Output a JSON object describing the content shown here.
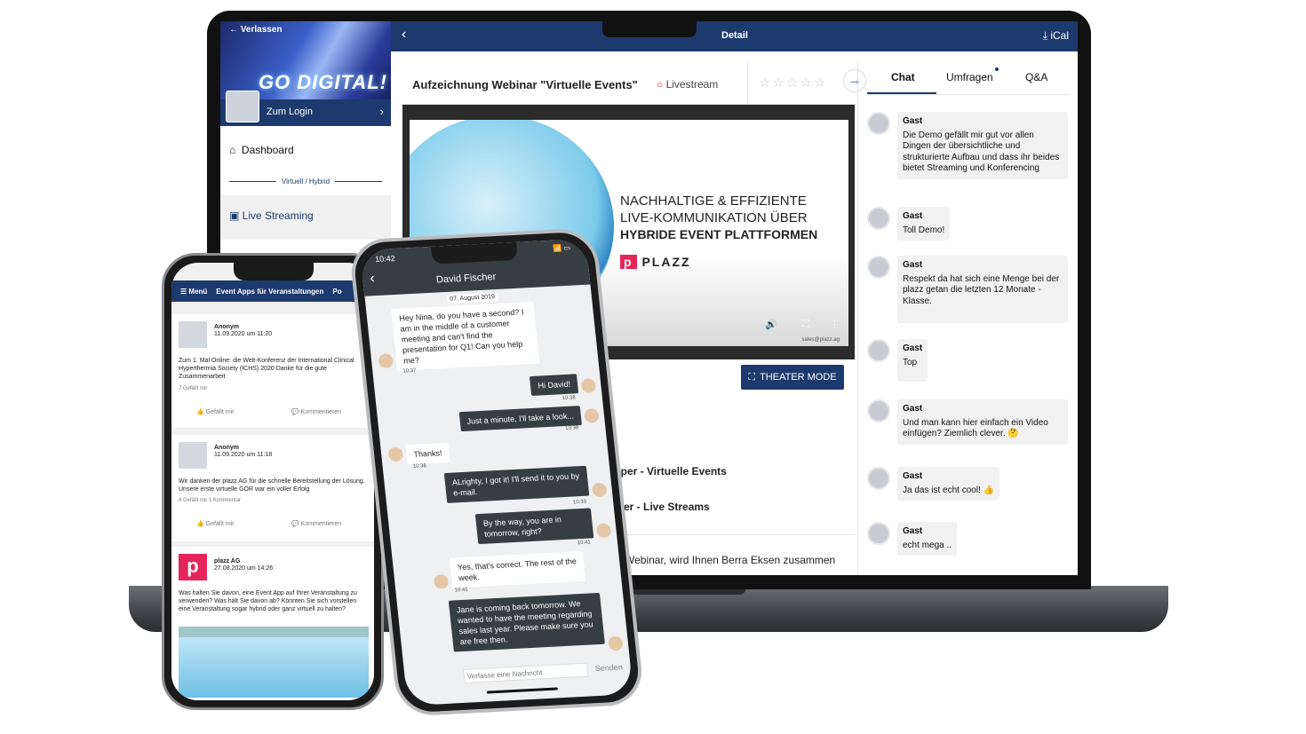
{
  "laptop": {
    "sidebar": {
      "leave": "Verlassen",
      "banner_text": "GO DIGITAL!",
      "login": "Zum Login",
      "items": [
        {
          "label": "Dashboard",
          "icon": "home-icon"
        },
        {
          "label": "Live Streaming",
          "icon": "video-camera-icon"
        }
      ],
      "section": "Virtuell / Hybrid"
    },
    "topbar": {
      "title": "Detail",
      "ical": "iCal"
    },
    "event": {
      "title": "Aufzeichnung Webinar \"Virtuelle Events\"",
      "badge": "Livestream",
      "rating": 0,
      "rating_max": 5
    },
    "slide": {
      "line1": "NACHHALTIGE & EFFIZIENTE",
      "line2": "LIVE-KOMMUNIKATION ÜBER",
      "line3": "HYBRIDE EVENT PLATTFORMEN",
      "brand": "PLAZZ",
      "email": "sales@plazz.ag"
    },
    "theater_mode": "THEATER MODE",
    "docs": [
      "epaper - Virtuelle Events",
      "aper - Live Streams"
    ],
    "description": "Webinar, wird Ihnen Berra Eksen zusammen",
    "tabs": [
      {
        "label": "Chat",
        "active": true
      },
      {
        "label": "Umfragen",
        "dot": true
      },
      {
        "label": "Q&A"
      }
    ],
    "chat": [
      {
        "user": "Gast",
        "text": "Die Demo gefällt mir gut vor allen Dingen der übersichtliche und strukturierte Aufbau und dass ihr beides bietet Streaming und Konferencing"
      },
      {
        "user": "Gast",
        "text": "Toll Demo!"
      },
      {
        "user": "Gast",
        "text": "Respekt da hat sich eine Menge bei der plazz getan die letzten 12 Monate - Klasse."
      },
      {
        "user": "Gast",
        "text": "Top"
      },
      {
        "user": "Gast",
        "text": "Und man kann hier einfach ein Video einfügen? Ziemlich clever. 🤔"
      },
      {
        "user": "Gast",
        "text": "Ja das ist echt cool! 👍"
      },
      {
        "user": "Gast",
        "text": "echt mega .."
      }
    ]
  },
  "phone_left": {
    "menu": "Menü",
    "title": "Event Apps für Veranstaltungen",
    "next": "Po",
    "posts": [
      {
        "author": "Anonym",
        "date": "11.09.2020 um 11:20",
        "text": "Zum 1. Mal Online: die Welt-Konferenz der International Clinical Hyperthermia Society (ICHS) 2020 Danke für die gute Zusammenarbeit",
        "stats": "7 Gefällt mir"
      },
      {
        "author": "Anonym",
        "date": "11.09.2020 um 11:18",
        "text": "Wir danken der plazz AG für die schnelle Bereitstellung der Lösung. Unsere erste virtuelle GOR war ein voller Erfolg",
        "stats": "4 Gefällt mir   1 Kommentar"
      },
      {
        "author": "plazz AG",
        "date": "27.08.2020 um 14:26",
        "text": "Was halten Sie davon, eine Event App auf Ihrer Veranstaltung zu verwenden? Was hält Sie davon ab? Könnten Sie sich vorstellen eine Veranstaltung sogar hybrid oder ganz virtuell zu halten?",
        "stats": ""
      }
    ],
    "like": "Gefällt mir",
    "comment": "Kommentieren"
  },
  "phone_right": {
    "time": "10:42",
    "contact": "David Fischer",
    "date": "07. August 2019",
    "messages": [
      {
        "dir": "in",
        "text": "Hey Nina, do you have a second? I am in the middle of a customer meeting and can't find the presentation for Q1! Can you help me?",
        "time": "10:37"
      },
      {
        "dir": "out",
        "text": "Hi David!",
        "time": "10:38"
      },
      {
        "dir": "out",
        "text": "Just a minute, I'll take a look...",
        "time": "10:38"
      },
      {
        "dir": "in",
        "text": "Thanks!",
        "time": "10:38"
      },
      {
        "dir": "out",
        "text": "ALrighty, I got it! I'll send it to you by e-mail.",
        "time": "10:39"
      },
      {
        "dir": "out",
        "text": "By the way, you are in tomorrow, right?",
        "time": "10:41"
      },
      {
        "dir": "in",
        "text": "Yes, that's correct. The rest of the week.",
        "time": "10:41"
      },
      {
        "dir": "out",
        "text": "Jane is coming back tomorrow. We wanted to have the meeting regarding sales last year. Please make sure you are free then.",
        "time": ""
      }
    ],
    "input_placeholder": "Verfasse eine Nachricht",
    "send": "Senden"
  },
  "colors": {
    "navy": "#1d3a6e",
    "livestream": "#e0302f",
    "brand": "#e5245b",
    "phone_chat_dark": "#363e41"
  }
}
